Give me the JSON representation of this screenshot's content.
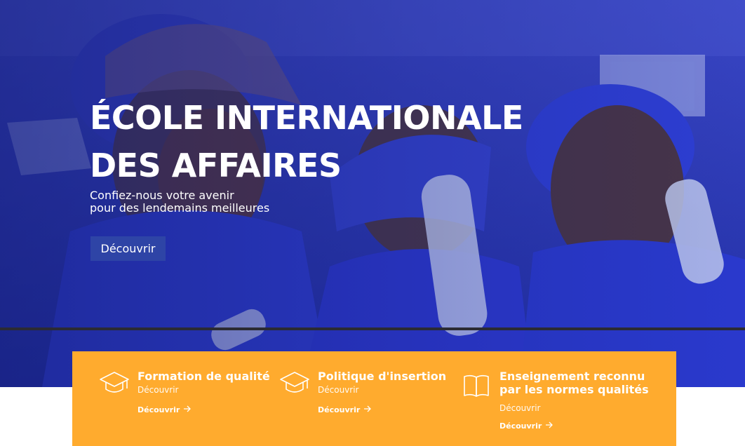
{
  "hero": {
    "title_line1": "ÉCOLE INTERNATIONALE",
    "title_line2": "DES AFFAIRES",
    "subtitle_line1": "Confiez-nous votre avenir",
    "subtitle_line2": "pour des lendemains meilleures",
    "cta_label": "Découvrir"
  },
  "features": [
    {
      "icon": "graduation-cap-icon",
      "title_line1": "Formation de qualité",
      "title_line2": "",
      "subtitle": "Découvrir",
      "link_label": "Découvrir"
    },
    {
      "icon": "graduation-cap-icon",
      "title_line1": "Politique d'insertion",
      "title_line2": "",
      "subtitle": "Découvrir",
      "link_label": "Découvrir"
    },
    {
      "icon": "open-book-icon",
      "title_line1": "Enseignement reconnu",
      "title_line2": "par les normes qualités",
      "subtitle": "Découvrir",
      "link_label": "Découvrir"
    }
  ],
  "colors": {
    "hero_tint": "#2a36b0",
    "button_blue": "#2e44a6",
    "feature_band": "#ffab2e",
    "text": "#ffffff"
  }
}
